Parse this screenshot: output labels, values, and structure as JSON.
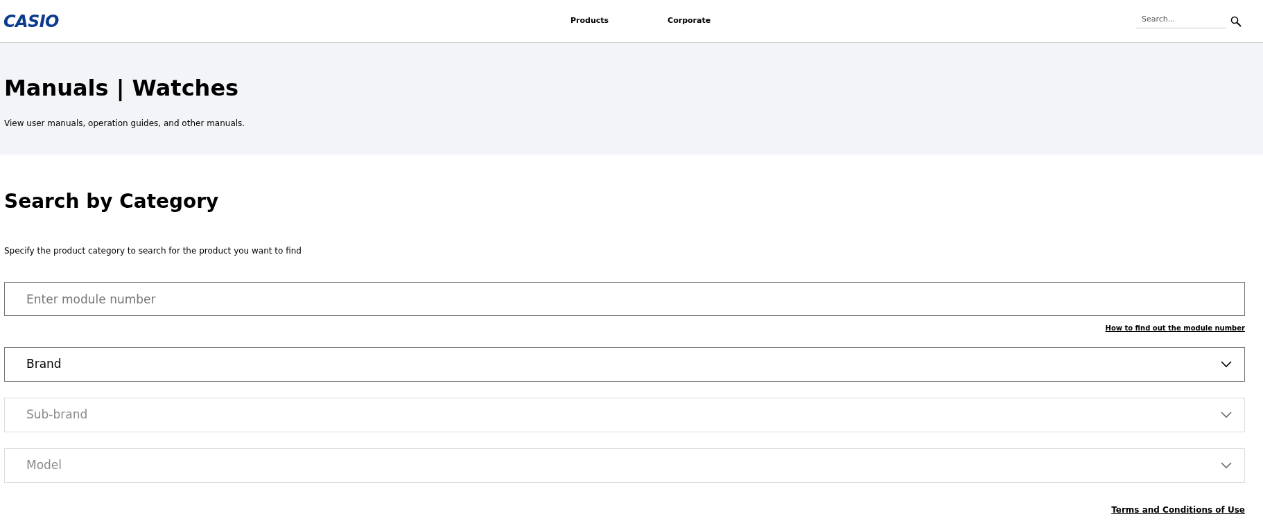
{
  "header": {
    "logo": "CASIO",
    "nav": [
      "Products",
      "Corporate"
    ],
    "search": {
      "placeholder": "Search..."
    }
  },
  "banner": {
    "title": "Manuals | Watches",
    "subtitle": "View user manuals, operation guides, and other manuals."
  },
  "section": {
    "title": "Search by Category",
    "description": "Specify the product category to search for the product you want to find",
    "module_field": {
      "placeholder": "Enter module number"
    },
    "help_link": "How to find out the module number",
    "dropdowns": [
      {
        "label": "Brand",
        "disabled": false
      },
      {
        "label": "Sub-brand",
        "disabled": true
      },
      {
        "label": "Model",
        "disabled": true
      }
    ]
  },
  "footer_link": "Terms and Conditions of Use"
}
